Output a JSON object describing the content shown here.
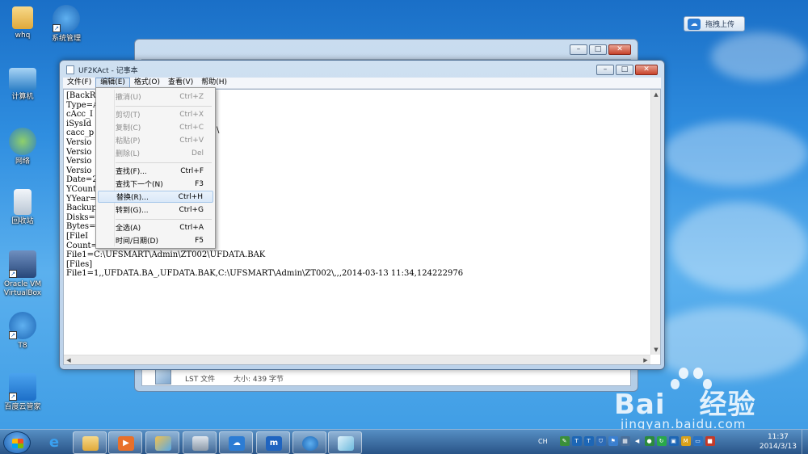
{
  "desktop": {
    "icons": [
      {
        "label": "whq",
        "icon": "folder-icon"
      },
      {
        "label": "系统管理",
        "icon": "system-manage-icon"
      },
      {
        "label": "计算机",
        "icon": "computer-icon"
      },
      {
        "label": "网络",
        "icon": "network-icon"
      },
      {
        "label": "回收站",
        "icon": "recycle-bin-icon"
      },
      {
        "label": "Oracle VM VirtualBox",
        "icon": "virtualbox-icon"
      },
      {
        "label": "T8",
        "icon": "t8-icon"
      },
      {
        "label": "百度云管家",
        "icon": "baidu-cloud-icon"
      }
    ],
    "upload_button": {
      "label": "拖拽上传"
    }
  },
  "back_window": {
    "file_type": "LST 文件",
    "file_size": "大小: 439 字节"
  },
  "notepad": {
    "title": "UF2KAct - 记事本",
    "menus": [
      "文件(F)",
      "编辑(E)",
      "格式(O)",
      "查看(V)",
      "帮助(H)"
    ],
    "lines": [
      "[BackR",
      "Type=A",
      "cAcc_I",
      "iSysId",
      "cacc_p",
      "Versio",
      "Versio",
      "Versio",
      "Versio",
      "Date=2",
      "YCount",
      "YYear=",
      "Backup",
      "Disks=",
      "Bytes=",
      "[FileI",
      "Count=",
      "File1=C:\\UFSMART\\Admin\\ZT002\\UFDATA.BAK",
      "[Files]",
      "File1=1,,UFDATA.BA_,UFDATA.BAK,C:\\UFSMART\\Admin\\ZT002\\,,,2014-03-13 11:34,124222976"
    ],
    "stray_char": "\\"
  },
  "edit_menu": {
    "items": [
      {
        "label": "撤消(U)",
        "key": "Ctrl+Z",
        "disabled": true
      },
      {
        "label": "剪切(T)",
        "key": "Ctrl+X",
        "disabled": true
      },
      {
        "label": "复制(C)",
        "key": "Ctrl+C",
        "disabled": true
      },
      {
        "label": "粘贴(P)",
        "key": "Ctrl+V",
        "disabled": true
      },
      {
        "label": "删除(L)",
        "key": "Del",
        "disabled": true
      },
      {
        "label": "查找(F)...",
        "key": "Ctrl+F",
        "disabled": false
      },
      {
        "label": "查找下一个(N)",
        "key": "F3",
        "disabled": false
      },
      {
        "label": "替换(R)...",
        "key": "Ctrl+H",
        "disabled": false,
        "hover": true
      },
      {
        "label": "转到(G)...",
        "key": "Ctrl+G",
        "disabled": false
      },
      {
        "label": "全选(A)",
        "key": "Ctrl+A",
        "disabled": false
      },
      {
        "label": "时间/日期(D)",
        "key": "F5",
        "disabled": false
      }
    ]
  },
  "taskbar": {
    "lang": "CH",
    "time": "11:37",
    "date": "2014/3/13"
  },
  "watermark": {
    "brand": "Bai",
    "brand_suffix": "经验",
    "url": "jingyan.baidu.com"
  }
}
